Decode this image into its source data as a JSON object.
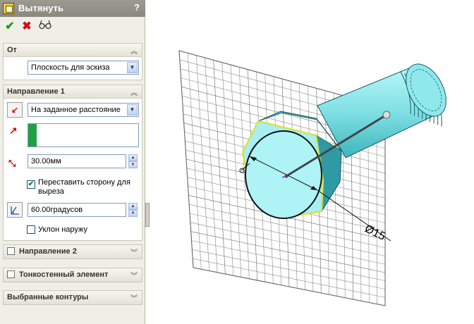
{
  "title": "Вытянуть",
  "help": "?",
  "toolbar": {
    "ok_icon": "check-icon",
    "cancel_icon": "cross-icon",
    "preview_icon": "glasses-icon"
  },
  "from": {
    "header": "От",
    "value": "Плоскость для эскиза"
  },
  "direction1": {
    "header": "Направление 1",
    "end_condition": "На заданное расстояние",
    "depth": "30.00мм",
    "flip_side": {
      "label": "Переставить сторону для выреза",
      "checked": true
    },
    "draft_angle": "60.00градусов",
    "draft_outward": {
      "label": "Уклон наружу",
      "checked": false
    }
  },
  "direction2": {
    "header": "Направление 2"
  },
  "thin_feature": {
    "header": "Тонкостенный элемент"
  },
  "selected_contours": {
    "header": "Выбранные контуры"
  },
  "model": {
    "dimension": "Ø15",
    "accent": "#7fe0e4"
  }
}
